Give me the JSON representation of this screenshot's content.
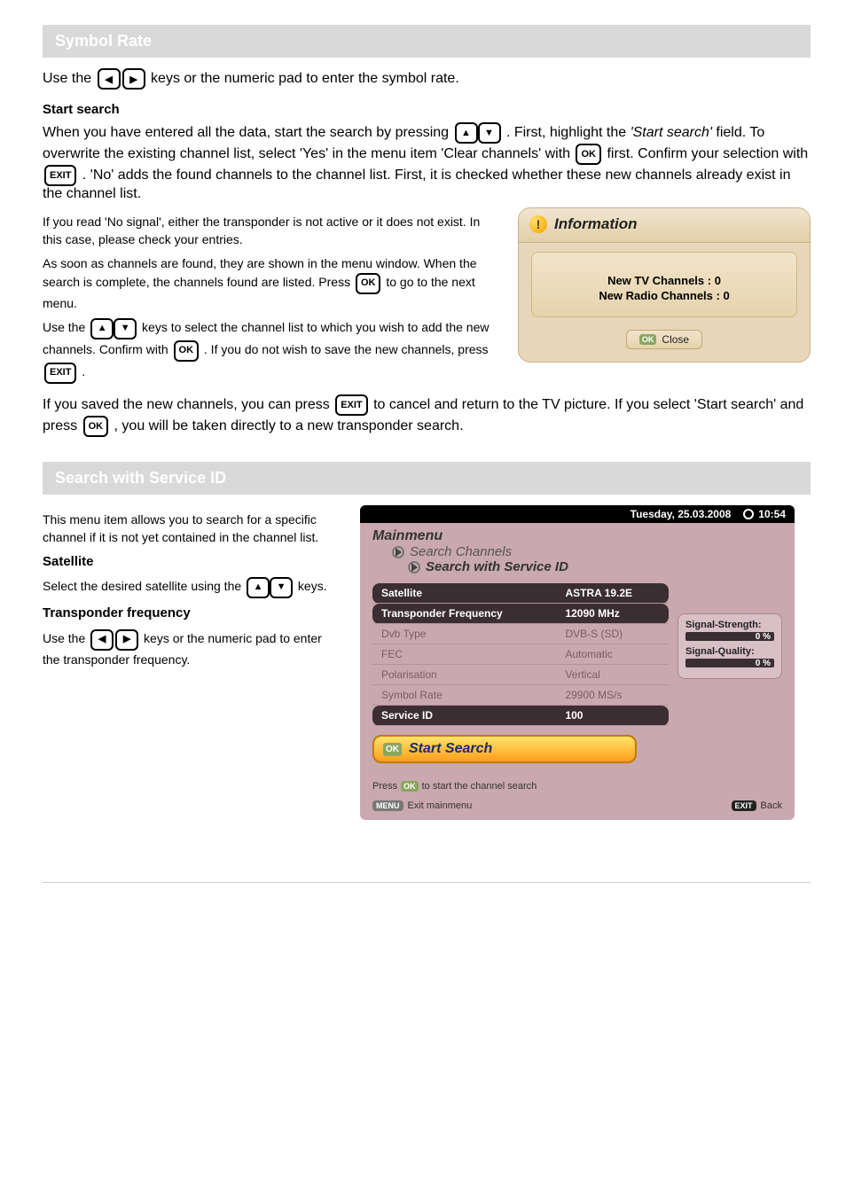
{
  "keys": {
    "left": "◀",
    "right": "▶",
    "up": "▲",
    "down": "▼",
    "ok": "OK",
    "exit": "EXIT"
  },
  "section1": {
    "header": "Symbol Rate",
    "p1_before_keys": "Use the",
    "p1_after_keys": "keys or the numeric pad to enter the symbol rate.",
    "startsearch_head": "Start search",
    "startsearch": {
      "p1_a": "When you have entered all the data, start the search by pressing",
      "p1_b": ". First, highlight the",
      "p1_c_em": "'Start search'",
      "p1_d": " field. To overwrite the existing channel list, select 'Yes' in the menu item 'Clear channels' with",
      "p1_e": " first. Confirm your selection with",
      "p1_f": ". 'No' adds the found channels to the channel list. First, it is checked whether these new channels already exist in the channel list."
    },
    "nosignal": {
      "p1_a": "If you read 'No signal', either the transponder is not active or it does not exist. In this case, please check your entries.",
      "p2_a": "As soon as channels are found, they are shown in the menu window. When the search is complete, the channels found are listed. Press ",
      "p2_b": " to go to the next menu.",
      "p3_a": "Use the ",
      "p3_b": " keys to select the channel list to which you wish to add the new channels. Confirm with ",
      "p3_c": ". If you do not wish to save the new channels, press ",
      "p3_d": "."
    },
    "save": {
      "p1_a": "If you saved the new channels, you can press ",
      "p1_b": " to cancel and return to the TV picture. If you select 'Start search' and press ",
      "p1_c": ", you will be taken directly to a new transponder search."
    },
    "info_dialog": {
      "title": "Information",
      "line1": "New TV Channels : 0",
      "line2": "New Radio Channels : 0",
      "close": "Close",
      "ok_badge": "OK"
    }
  },
  "section2": {
    "header": "Search with Service ID",
    "intro": "This menu item allows you to search for a specific channel if it is not yet contained in the channel list.",
    "satellite_head": "Satellite",
    "satellite": {
      "p1_a": "Select the desired satellite using the ",
      "p1_b": " keys."
    },
    "freq_head": "Transponder frequency",
    "freq": {
      "p1_a": "Use the ",
      "p1_b": " keys or the numeric pad to enter the transponder frequency."
    },
    "menu_fig": {
      "sysbar": {
        "date": "Tuesday, 25.03.2008",
        "time": "10:54",
        "clock_icon": "clock"
      },
      "crumbs": {
        "l1": "Mainmenu",
        "l2": "Search Channels",
        "l3": "Search with Service ID"
      },
      "rows": [
        {
          "k": "Satellite",
          "v": "ASTRA 19.2E",
          "mode": "on"
        },
        {
          "k": "Transponder Frequency",
          "v": "12090 MHz",
          "mode": "on"
        },
        {
          "k": "Dvb Type",
          "v": "DVB-S (SD)",
          "mode": "off"
        },
        {
          "k": "FEC",
          "v": "Automatic",
          "mode": "off"
        },
        {
          "k": "Polarisation",
          "v": "Vertical",
          "mode": "off"
        },
        {
          "k": "Symbol Rate",
          "v": "29900 MS/s",
          "mode": "off"
        },
        {
          "k": "Service ID",
          "v": "100",
          "mode": "on"
        }
      ],
      "signal": {
        "strength_label": "Signal-Strength:",
        "strength_value": "0 %",
        "quality_label": "Signal-Quality:",
        "quality_value": "0 %"
      },
      "start_btn": {
        "ok_badge": "OK",
        "label": "Start Search"
      },
      "helper": {
        "pre": "Press",
        "ok_badge": "OK",
        "post": "to start the channel search"
      },
      "bottom": {
        "menu_key": "MENU",
        "menu_label": "Exit mainmenu",
        "exit_key": "EXIT",
        "exit_label": "Back"
      }
    }
  }
}
